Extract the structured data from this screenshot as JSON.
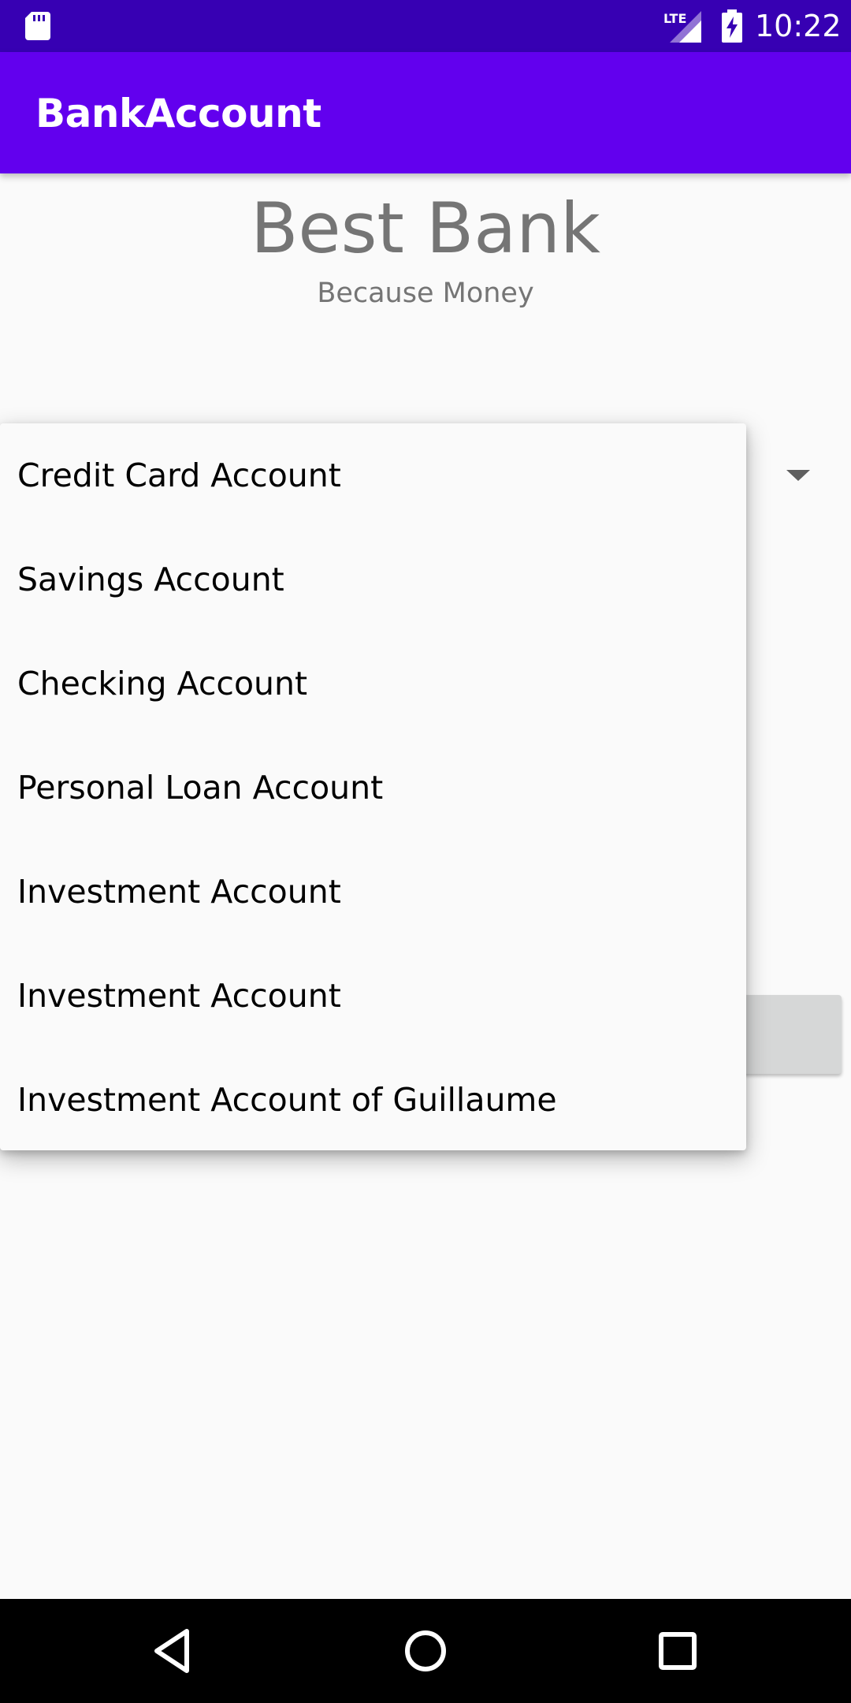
{
  "status_bar": {
    "time": "10:22",
    "network": "LTE",
    "icons": [
      "sd-card-icon",
      "lte-signal-icon",
      "battery-charging-icon"
    ]
  },
  "app_bar": {
    "title": "BankAccount",
    "color": "#6200ee"
  },
  "header": {
    "title": "Best Bank",
    "subtitle": "Because Money"
  },
  "account_dropdown": {
    "items": [
      "Credit Card Account",
      "Savings Account",
      "Checking Account",
      "Personal Loan Account",
      "Investment Account",
      "Investment Account",
      "Investment Account of Guillaume"
    ]
  },
  "colors": {
    "status_bar": "#3700b3",
    "app_bar": "#6200ee",
    "background": "#fafafa",
    "text_secondary": "#757575"
  },
  "nav_bar": {
    "icons": [
      "back-icon",
      "home-icon",
      "recents-icon"
    ]
  }
}
